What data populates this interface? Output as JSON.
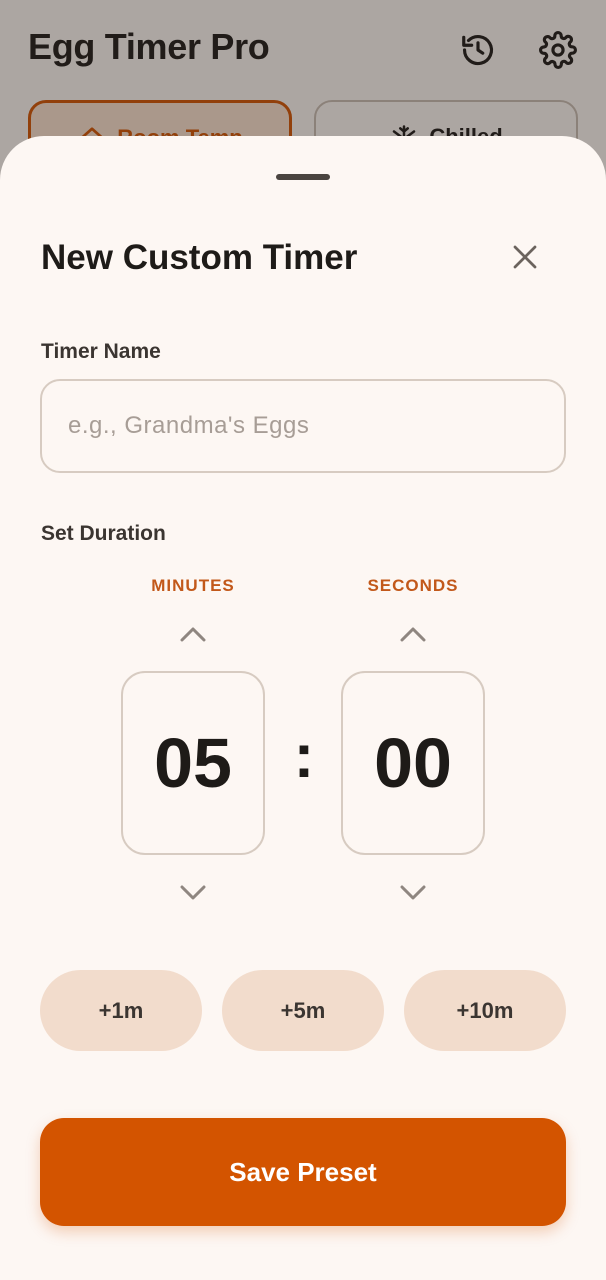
{
  "app": {
    "title": "Egg Timer Pro",
    "icons": {
      "history": "history-icon",
      "settings": "gear-icon"
    },
    "presets": [
      {
        "label": "Room Temp",
        "icon": "home-icon",
        "selected": true
      },
      {
        "label": "Chilled",
        "icon": "snowflake-icon",
        "selected": false
      }
    ]
  },
  "sheet": {
    "title": "New Custom Timer",
    "close_icon": "close-icon",
    "timer_name": {
      "label": "Timer Name",
      "value": "",
      "placeholder": "e.g., Grandma's Eggs"
    },
    "duration": {
      "label": "Set Duration",
      "minutes": {
        "label": "MINUTES",
        "value": "05"
      },
      "seconds": {
        "label": "SECONDS",
        "value": "00"
      },
      "separator": ":"
    },
    "quick_add": [
      "+1m",
      "+5m",
      "+10m"
    ],
    "save_label": "Save Preset"
  },
  "colors": {
    "accent": "#d35400",
    "accent_soft": "#f2dccc",
    "label_accent": "#c2581a",
    "text_primary": "#1e1b18",
    "sheet_bg": "#fdf7f3",
    "scrim": "rgba(40,32,28,0.38)"
  }
}
